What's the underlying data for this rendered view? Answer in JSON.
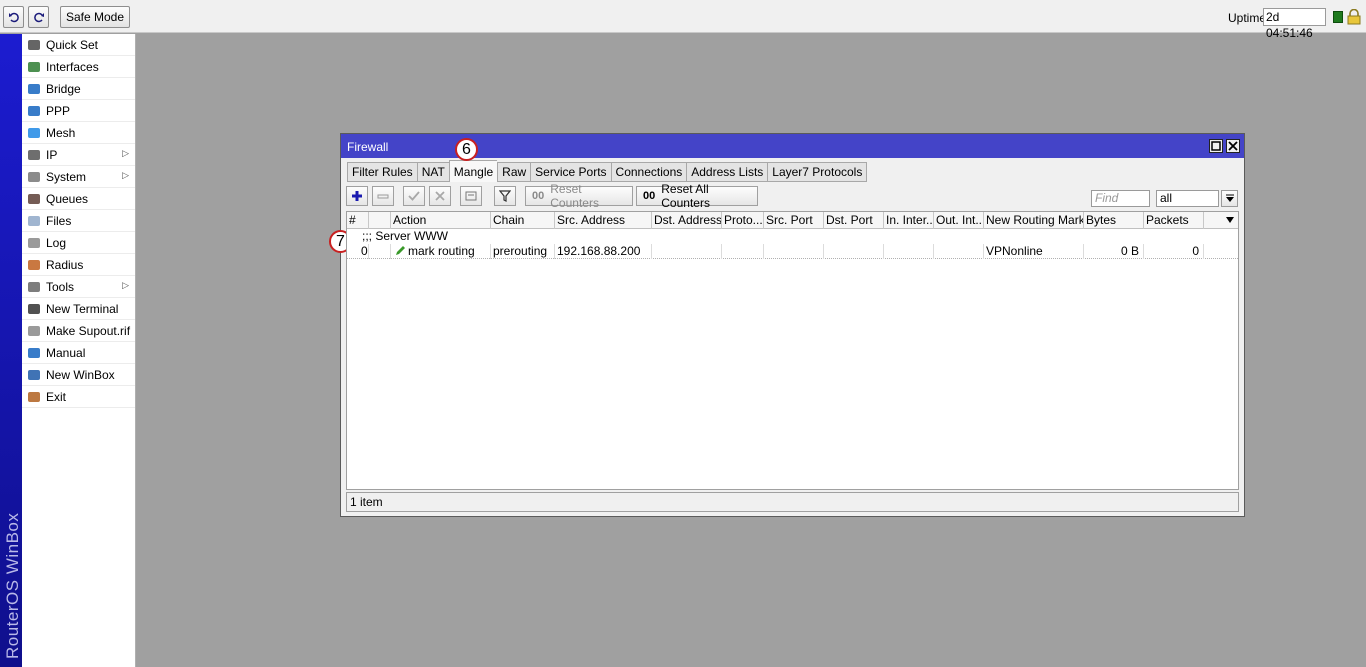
{
  "topbar": {
    "undo_icon": "undo-icon",
    "redo_icon": "redo-icon",
    "safe_mode_label": "Safe Mode",
    "uptime_label": "Uptime:",
    "uptime_value": "2d 04:51:46"
  },
  "brand": {
    "text": "RouterOS WinBox"
  },
  "sidebar": {
    "items": [
      {
        "label": "Quick Set",
        "icon": "quick-set-icon"
      },
      {
        "label": "Interfaces",
        "icon": "interfaces-icon"
      },
      {
        "label": "Bridge",
        "icon": "bridge-icon"
      },
      {
        "label": "PPP",
        "icon": "ppp-icon"
      },
      {
        "label": "Mesh",
        "icon": "mesh-icon"
      },
      {
        "label": "IP",
        "icon": "ip-icon",
        "has_submenu": true
      },
      {
        "label": "System",
        "icon": "system-icon",
        "has_submenu": true
      },
      {
        "label": "Queues",
        "icon": "queues-icon"
      },
      {
        "label": "Files",
        "icon": "files-icon"
      },
      {
        "label": "Log",
        "icon": "log-icon"
      },
      {
        "label": "Radius",
        "icon": "radius-icon"
      },
      {
        "label": "Tools",
        "icon": "tools-icon",
        "has_submenu": true
      },
      {
        "label": "New Terminal",
        "icon": "terminal-icon"
      },
      {
        "label": "Make Supout.rif",
        "icon": "supout-icon"
      },
      {
        "label": "Manual",
        "icon": "manual-icon"
      },
      {
        "label": "New WinBox",
        "icon": "winbox-icon"
      },
      {
        "label": "Exit",
        "icon": "exit-icon"
      }
    ]
  },
  "firewall": {
    "title": "Firewall",
    "tabs": [
      "Filter Rules",
      "NAT",
      "Mangle",
      "Raw",
      "Service Ports",
      "Connections",
      "Address Lists",
      "Layer7 Protocols"
    ],
    "active_tab": "Mangle",
    "callouts": {
      "tab": "6",
      "row": "7"
    },
    "toolbar": {
      "reset_counters": "Reset Counters",
      "reset_all_counters": "Reset All Counters",
      "counter_glyph": "00",
      "find_placeholder": "Find",
      "filter_value": "all"
    },
    "columns": [
      "#",
      "",
      "Action",
      "Chain",
      "Src. Address",
      "Dst. Address",
      "Proto...",
      "Src. Port",
      "Dst. Port",
      "In. Inter...",
      "Out. Int...",
      "New Routing Mark",
      "Bytes",
      "Packets"
    ],
    "group_comment": ";;; Server WWW",
    "rows": [
      {
        "num": "0",
        "action": "mark routing",
        "chain": "prerouting",
        "src_address": "192.168.88.200",
        "dst_address": "",
        "protocol": "",
        "src_port": "",
        "dst_port": "",
        "in_interface": "",
        "out_interface": "",
        "new_routing_mark": "VPNonline",
        "bytes": "0 B",
        "packets": "0"
      }
    ],
    "status": "1 item"
  },
  "colors": {
    "titlebar": "#4444c8",
    "brand_strip": "#1c1cd0",
    "desktop": "#a0a0a0",
    "callout_border": "#c82020"
  }
}
